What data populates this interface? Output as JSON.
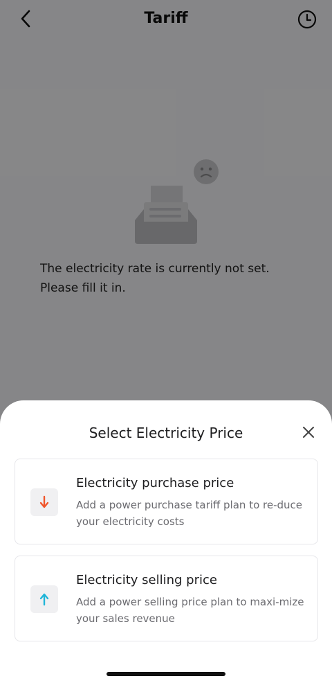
{
  "header": {
    "title": "Tariff",
    "back_icon": "chevron-left-icon",
    "history_icon": "clock-icon"
  },
  "empty_state": {
    "illustration_icon": "empty-inbox-sad-icon",
    "message": "The electricity rate is currently not set. Please fill it in."
  },
  "sheet": {
    "title": "Select Electricity Price",
    "close_icon": "close-icon",
    "options": [
      {
        "title": "Electricity purchase price",
        "description": "Add a power purchase tariff plan to re-duce your electricity costs",
        "icon": "arrow-down-icon",
        "icon_color": "#f0552b"
      },
      {
        "title": "Electricity selling price",
        "description": "Add a power selling price plan to maxi-mize your sales revenue",
        "icon": "arrow-up-icon",
        "icon_color": "#1fb5d8"
      }
    ]
  },
  "colors": {
    "overlay": "#8a8a8d",
    "sheet_bg": "#ffffff",
    "card_border": "#e6e6ea"
  }
}
